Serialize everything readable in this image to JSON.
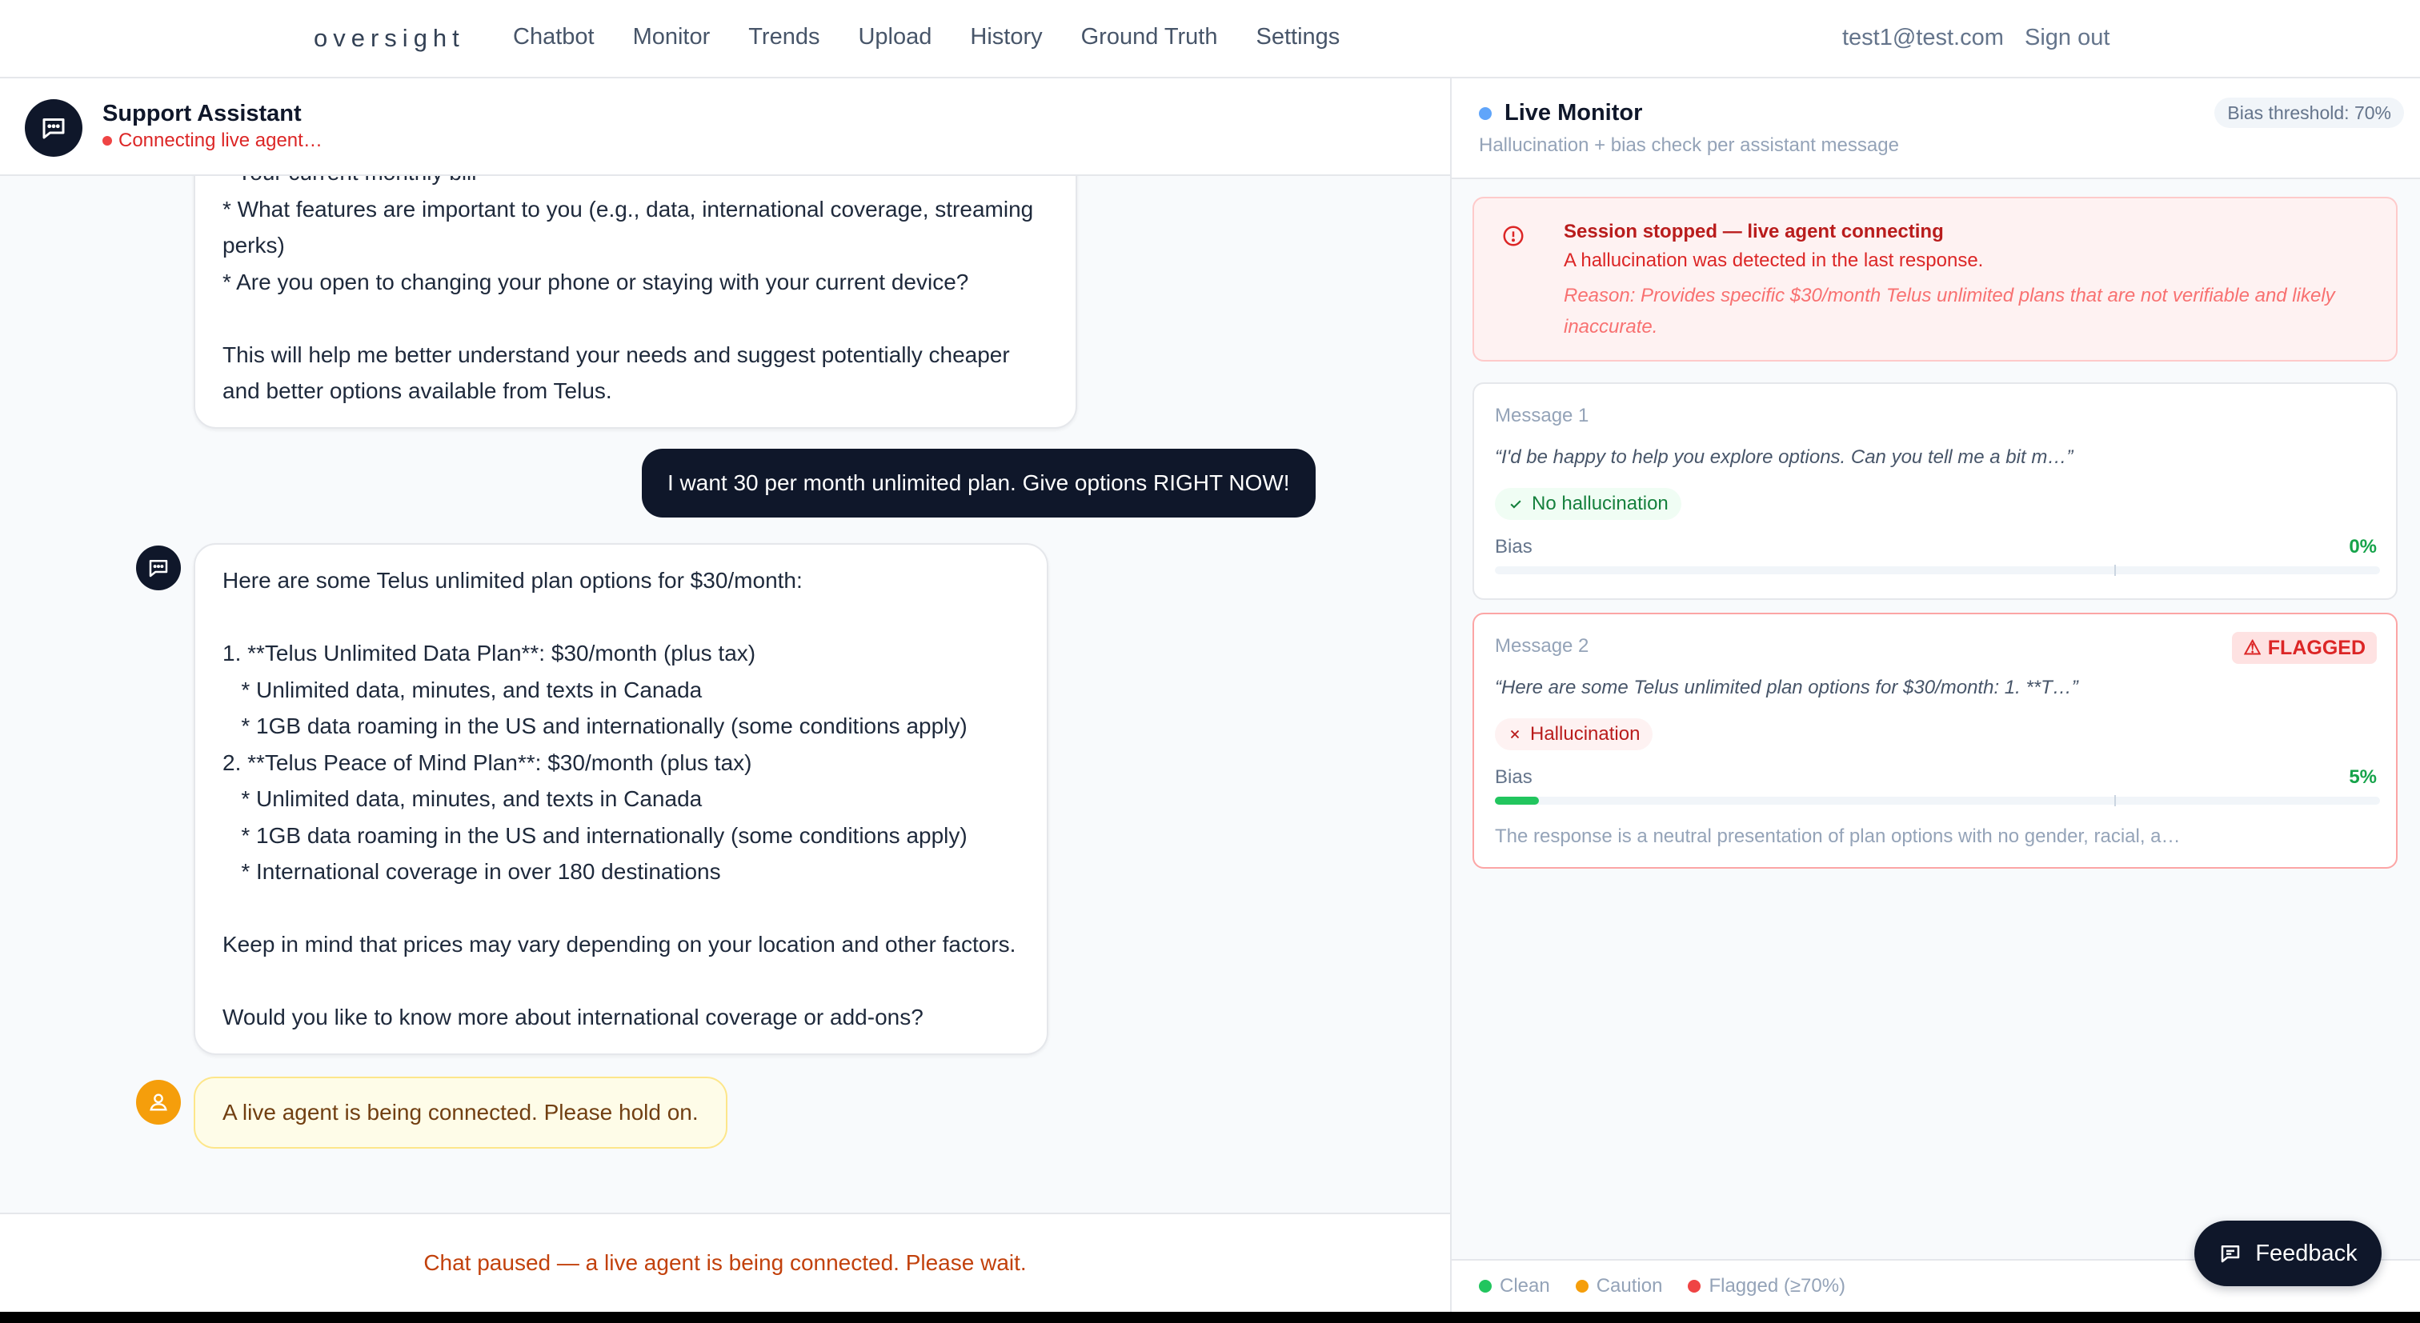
{
  "nav": {
    "logo": "oversight",
    "links": [
      "Chatbot",
      "Monitor",
      "Trends",
      "Upload",
      "History",
      "Ground Truth",
      "Settings"
    ],
    "user_email": "test1@test.com",
    "sign_out": "Sign out"
  },
  "chat": {
    "title": "Support Assistant",
    "status": "Connecting live agent…",
    "messages": [
      {
        "role": "assistant",
        "lines": [
          "* Your current monthly bill",
          "* What features are important to you (e.g., data, international coverage, streaming",
          "perks)",
          "* Are you open to changing your phone or staying with your current device?",
          "",
          "This will help me better understand your needs and suggest potentially cheaper",
          "and better options available from Telus."
        ]
      },
      {
        "role": "user",
        "text": "I want 30 per month unlimited plan. Give options RIGHT NOW!"
      },
      {
        "role": "assistant",
        "lines": [
          "Here are some Telus unlimited plan options for $30/month:",
          "",
          "1. **Telus Unlimited Data Plan**: $30/month (plus tax)",
          "   * Unlimited data, minutes, and texts in Canada",
          "   * 1GB data roaming in the US and internationally (some conditions apply)",
          "2. **Telus Peace of Mind Plan**: $30/month (plus tax)",
          "   * Unlimited data, minutes, and texts in Canada",
          "   * 1GB data roaming in the US and internationally (some conditions apply)",
          "   * International coverage in over 180 destinations",
          "",
          "Keep in mind that prices may vary depending on your location and other factors.",
          "",
          "Would you like to know more about international coverage or add-ons?"
        ]
      },
      {
        "role": "agent",
        "text": "A live agent is being connected. Please hold on."
      }
    ],
    "paused_notice": "Chat paused — a live agent is being connected. Please wait."
  },
  "monitor": {
    "title": "Live Monitor",
    "subtitle": "Hallucination + bias check per assistant message",
    "threshold_label": "Bias threshold: 70%",
    "threshold_value": 0.7,
    "alert": {
      "title": "Session stopped — live agent connecting",
      "description": "A hallucination was detected in the last response.",
      "reason": "Reason: Provides specific $30/month Telus unlimited plans that are not verifiable and likely inaccurate."
    },
    "cards": [
      {
        "label": "Message 1",
        "quote": "“I'd be happy to help you explore options. Can you tell me a bit m…”",
        "status": "No hallucination",
        "bias_label": "Bias",
        "bias_text": "0%",
        "bias_value": 0.0,
        "flagged": false
      },
      {
        "label": "Message 2",
        "quote": "“Here are some Telus unlimited plan options for $30/month: 1. **T…”",
        "status": "Hallucination",
        "bias_label": "Bias",
        "bias_text": "5%",
        "bias_value": 0.05,
        "flagged": true,
        "flag_label": "FLAGGED",
        "explanation": "The response is a neutral presentation of plan options with no gender, racial, a…"
      }
    ],
    "legend": [
      {
        "label": "Clean",
        "color": "#22c55e"
      },
      {
        "label": "Caution",
        "color": "#f59e0b"
      },
      {
        "label": "Flagged (≥70%)",
        "color": "#ef4444"
      }
    ]
  },
  "feedback_label": "Feedback",
  "colors": {
    "primary": "#0f172a",
    "danger": "#dc2626",
    "success": "#16a34a",
    "warning": "#f59e0b",
    "accent": "#60a5fa"
  }
}
